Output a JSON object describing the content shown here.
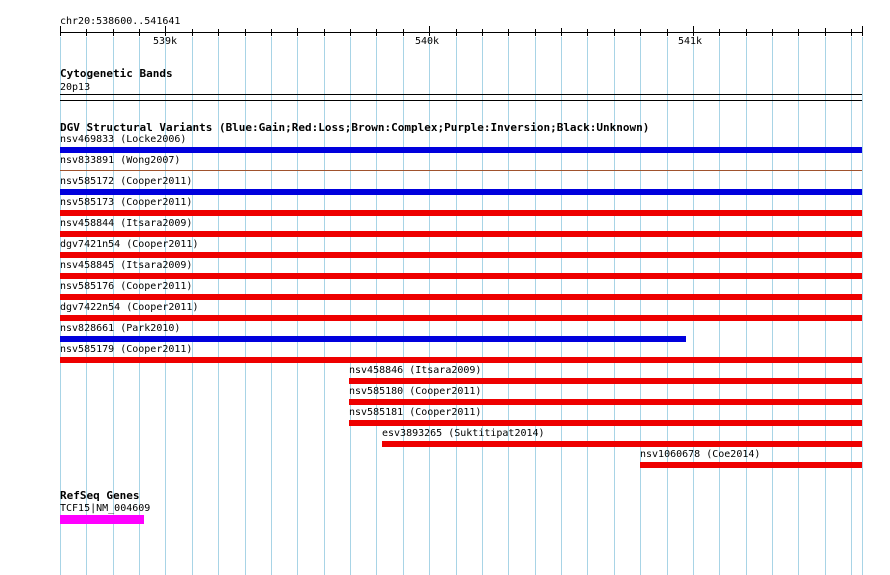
{
  "ruler": {
    "region": "chr20:538600..541641",
    "ticks": [
      {
        "label": "539k",
        "pos": 539000
      },
      {
        "label": "540k",
        "pos": 540000
      },
      {
        "label": "541k",
        "pos": 541000
      }
    ]
  },
  "cytoband": {
    "title": "Cytogenetic Bands",
    "band": "20p13"
  },
  "dgv": {
    "title": "DGV Structural Variants (Blue:Gain;Red:Loss;Brown:Complex;Purple:Inversion;Black:Unknown)",
    "variants": [
      {
        "label": "nsv469833 (Locke2006)",
        "start": 538600,
        "end": 541641,
        "type": "Gain",
        "color": "#0000dd"
      },
      {
        "label": "nsv833891 (Wong2007)",
        "start": 538600,
        "end": 541641,
        "type": "Complex",
        "color": "#a0522d"
      },
      {
        "label": "nsv585172 (Cooper2011)",
        "start": 538600,
        "end": 541641,
        "type": "Gain",
        "color": "#0000dd"
      },
      {
        "label": "nsv585173 (Cooper2011)",
        "start": 538600,
        "end": 541641,
        "type": "Loss",
        "color": "#ee0000"
      },
      {
        "label": "nsv458844 (Itsara2009)",
        "start": 538600,
        "end": 541641,
        "type": "Loss",
        "color": "#ee0000"
      },
      {
        "label": "dgv7421n54 (Cooper2011)",
        "start": 538600,
        "end": 541641,
        "type": "Loss",
        "color": "#ee0000"
      },
      {
        "label": "nsv458845 (Itsara2009)",
        "start": 538600,
        "end": 541641,
        "type": "Loss",
        "color": "#ee0000"
      },
      {
        "label": "nsv585176 (Cooper2011)",
        "start": 538600,
        "end": 541641,
        "type": "Loss",
        "color": "#ee0000"
      },
      {
        "label": "dgv7422n54 (Cooper2011)",
        "start": 538600,
        "end": 541641,
        "type": "Loss",
        "color": "#ee0000"
      },
      {
        "label": "nsv828661 (Park2010)",
        "start": 538600,
        "end": 540975,
        "type": "Gain",
        "color": "#0000dd"
      },
      {
        "label": "nsv585179 (Cooper2011)",
        "start": 538600,
        "end": 541641,
        "type": "Loss",
        "color": "#ee0000"
      },
      {
        "label": "nsv458846 (Itsara2009)",
        "start": 539695,
        "end": 541641,
        "type": "Loss",
        "color": "#ee0000"
      },
      {
        "label": "nsv585180 (Cooper2011)",
        "start": 539695,
        "end": 541641,
        "type": "Loss",
        "color": "#ee0000"
      },
      {
        "label": "nsv585181 (Cooper2011)",
        "start": 539695,
        "end": 541641,
        "type": "Loss",
        "color": "#ee0000"
      },
      {
        "label": "esv3893265 (Suktitipat2014)",
        "start": 539820,
        "end": 541641,
        "type": "Loss",
        "color": "#ee0000"
      },
      {
        "label": "nsv1060678 (Coe2014)",
        "start": 540800,
        "end": 541641,
        "type": "Loss",
        "color": "#ee0000"
      }
    ]
  },
  "refseq": {
    "title": "RefSeq Genes",
    "genes": [
      {
        "label": "TCF15|NM_004609",
        "start": 538600,
        "end": 538920,
        "color": "#ff00ff"
      }
    ]
  }
}
